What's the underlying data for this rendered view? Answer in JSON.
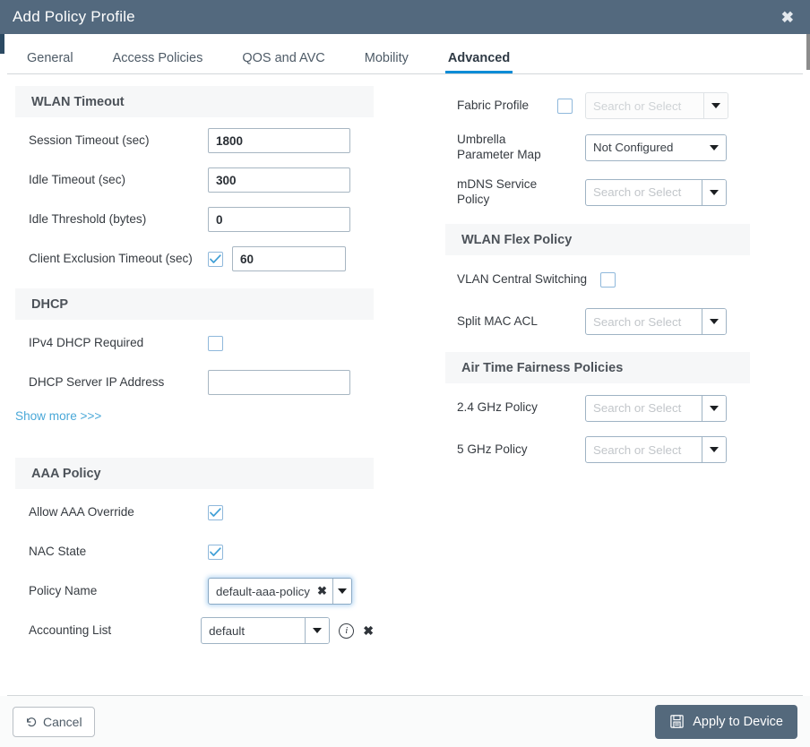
{
  "window": {
    "title": "Add Policy Profile",
    "close_icon": "close-icon"
  },
  "tabs": [
    {
      "label": "General",
      "active": false
    },
    {
      "label": "Access Policies",
      "active": false
    },
    {
      "label": "QOS and AVC",
      "active": false
    },
    {
      "label": "Mobility",
      "active": false
    },
    {
      "label": "Advanced",
      "active": true
    }
  ],
  "left_column": {
    "wlan_timeout": {
      "heading": "WLAN Timeout",
      "session_timeout_label": "Session Timeout (sec)",
      "session_timeout_value": "1800",
      "idle_timeout_label": "Idle Timeout (sec)",
      "idle_timeout_value": "300",
      "idle_threshold_label": "Idle Threshold (bytes)",
      "idle_threshold_value": "0",
      "client_exclusion_label": "Client Exclusion Timeout (sec)",
      "client_exclusion_checked": "checked",
      "client_exclusion_value": "60"
    },
    "dhcp": {
      "heading": "DHCP",
      "ipv4_required_label": "IPv4 DHCP Required",
      "ipv4_required_checked": "unchecked",
      "server_ip_label": "DHCP Server IP Address",
      "server_ip_value": "",
      "show_more_label": "Show more >>>"
    },
    "aaa_policy": {
      "heading": "AAA Policy",
      "allow_override_label": "Allow AAA Override",
      "allow_override_checked": "checked",
      "nac_state_label": "NAC State",
      "nac_state_checked": "checked",
      "policy_name_label": "Policy Name",
      "policy_name_value": "default-aaa-policy",
      "policy_name_clear": "✖",
      "accounting_list_label": "Accounting List",
      "accounting_list_value": "default",
      "accounting_info_icon": "i",
      "accounting_delete_icon": "✖"
    }
  },
  "right_column": {
    "fabric_profile_label": "Fabric Profile",
    "fabric_profile_checked": "unchecked",
    "fabric_profile_placeholder": "Search or Select",
    "umbrella_label": "Umbrella Parameter Map",
    "umbrella_value": "Not Configured",
    "mdns_label": "mDNS Service Policy",
    "mdns_placeholder": "Search or Select",
    "wlan_flex_policy": {
      "heading": "WLAN Flex Policy",
      "vlan_central_switching_label": "VLAN Central Switching",
      "vlan_central_switching_checked": "unchecked",
      "split_mac_acl_label": "Split MAC ACL",
      "split_mac_acl_placeholder": "Search or Select"
    },
    "air_time_fairness": {
      "heading": "Air Time Fairness Policies",
      "policy_24_label": "2.4 GHz Policy",
      "policy_24_placeholder": "Search or Select",
      "policy_5_label": "5 GHz Policy",
      "policy_5_placeholder": "Search or Select"
    }
  },
  "footer": {
    "cancel_label": "Cancel",
    "apply_label": "Apply to Device"
  },
  "colors": {
    "titlebar": "#53697e",
    "accent_tab": "#0d8cd6",
    "link": "#4aa8d8",
    "apply_button": "#54697c",
    "section_header_bg": "#f6f7f8"
  }
}
